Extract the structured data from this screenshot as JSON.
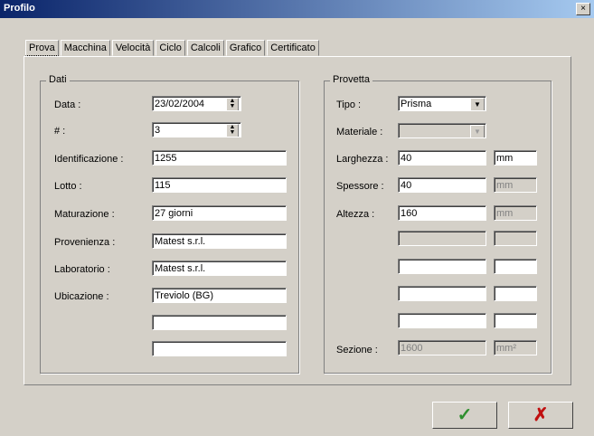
{
  "window": {
    "title": "Profilo",
    "close_glyph": "×"
  },
  "tabs": [
    {
      "label": "Prova",
      "active": true
    },
    {
      "label": "Macchina"
    },
    {
      "label": "Velocità"
    },
    {
      "label": "Ciclo"
    },
    {
      "label": "Calcoli"
    },
    {
      "label": "Grafico"
    },
    {
      "label": "Certificato"
    }
  ],
  "dati": {
    "title": "Dati",
    "data_label": "Data :",
    "data_value": "23/02/2004",
    "num_label": "# :",
    "num_value": "3",
    "identificazione_label": "Identificazione :",
    "identificazione_value": "1255",
    "lotto_label": "Lotto :",
    "lotto_value": "115",
    "maturazione_label": "Maturazione :",
    "maturazione_value": "27 giorni",
    "provenienza_label": "Provenienza :",
    "provenienza_value": "Matest s.r.l.",
    "laboratorio_label": "Laboratorio :",
    "laboratorio_value": "Matest s.r.l.",
    "ubicazione_label": "Ubicazione :",
    "ubicazione_value": "Treviolo (BG)",
    "extra1_value": "",
    "extra2_value": ""
  },
  "provetta": {
    "title": "Provetta",
    "tipo_label": "Tipo :",
    "tipo_value": "Prisma",
    "materiale_label": "Materiale :",
    "materiale_value": "",
    "larghezza_label": "Larghezza :",
    "larghezza_value": "40",
    "larghezza_unit": "mm",
    "spessore_label": "Spessore :",
    "spessore_value": "40",
    "spessore_unit": "mm",
    "altezza_label": "Altezza :",
    "altezza_value": "160",
    "altezza_unit": "mm",
    "sezione_label": "Sezione :",
    "sezione_value": "1600",
    "sezione_unit": "mm²"
  },
  "buttons": {
    "ok_glyph": "✓",
    "cancel_glyph": "✗"
  },
  "icons": {
    "ok": "checkmark-icon",
    "cancel": "x-icon",
    "dropdown": "chevron-down-icon",
    "spin": "spin-arrows-icon"
  }
}
